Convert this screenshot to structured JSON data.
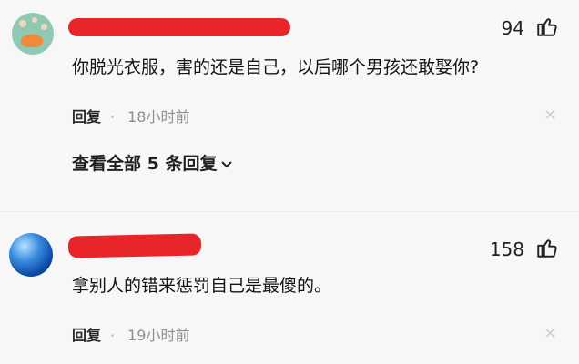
{
  "comments": [
    {
      "avatar_icon": "mustard-bottle-avatar",
      "like_count": "94",
      "text": "你脱光衣服，害的还是自己，以后哪个男孩还敢娶你?",
      "reply_label": "回复",
      "separator": "·",
      "time": "18小时前",
      "close_icon": "×"
    },
    {
      "avatar_icon": "earth-globe-avatar",
      "like_count": "158",
      "text": "拿别人的错来惩罚自己是最傻的。",
      "reply_label": "回复",
      "separator": "·",
      "time": "19小时前",
      "close_icon": "×"
    }
  ],
  "view_all_replies": "查看全部 5 条回复",
  "colors": {
    "redaction": "#e8262a",
    "background": "#f7f7f8"
  }
}
